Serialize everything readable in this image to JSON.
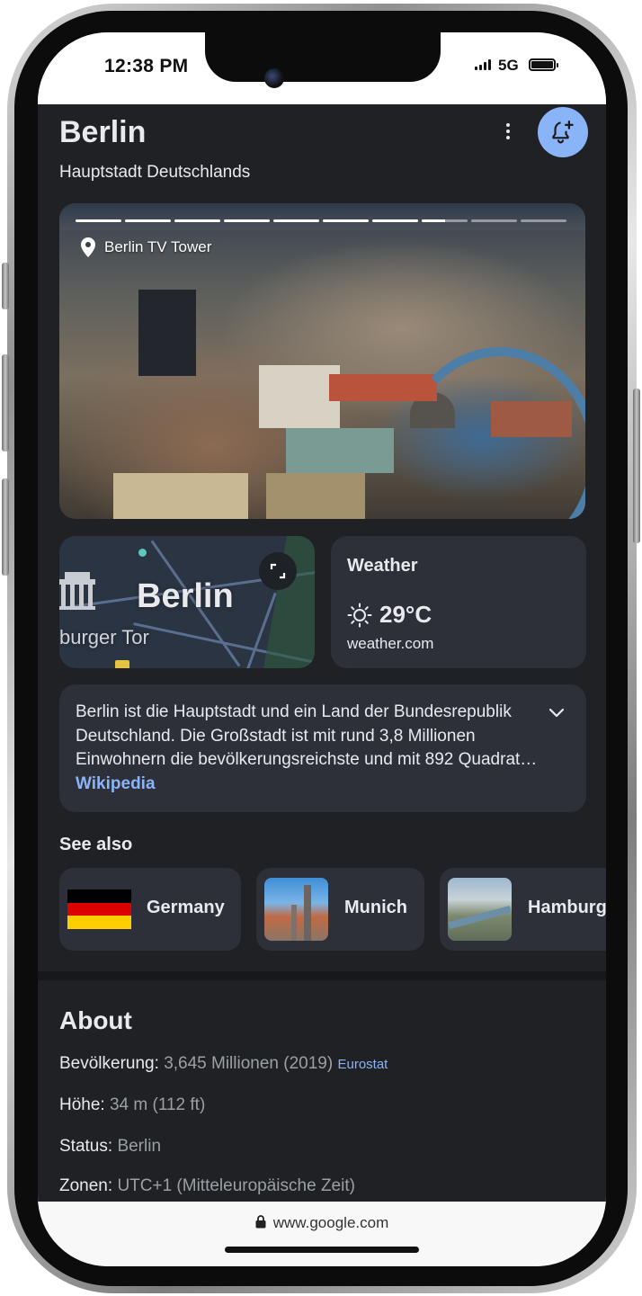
{
  "status_bar": {
    "time": "12:38 PM",
    "network": "5G",
    "battery_icon": "battery-full-icon"
  },
  "header": {
    "title": "Berlin",
    "subtitle": "Hauptstadt Deutschlands",
    "menu_icon": "more-vert-icon",
    "bell_icon": "bell-add-icon"
  },
  "hero": {
    "location_label": "Berlin TV Tower",
    "slide_count": 10,
    "current_slide": 8,
    "current_slide_progress": 0.5
  },
  "map": {
    "city_label": "Berlin",
    "landmark_label": "burger Tor",
    "expand_icon": "expand-icon"
  },
  "weather": {
    "title": "Weather",
    "temperature": "29°C",
    "condition_icon": "sun-icon",
    "source": "weather.com"
  },
  "description": {
    "text": "Berlin ist die Hauptstadt und ein Land der Bundesrepublik Deutschland. Die Großstadt ist mit rund 3,8 Millionen Einwohnern die bevölkerungsreichste und mit 892 Quadrat…",
    "link": "Wikipedia"
  },
  "see_also": {
    "title": "See also",
    "items": [
      {
        "label": "Germany"
      },
      {
        "label": "Munich"
      },
      {
        "label": "Hamburg"
      }
    ]
  },
  "about": {
    "title": "About",
    "facts": [
      {
        "label": "Bevölkerung:",
        "value": "3,645 Millionen (2019)",
        "source": "Eurostat"
      },
      {
        "label": "Höhe:",
        "value": "34 m (112 ft)"
      },
      {
        "label": "Status:",
        "value": "Berlin"
      },
      {
        "label": "Zonen:",
        "value": "UTC+1 (Mitteleuropäische Zeit)"
      }
    ]
  },
  "url_bar": {
    "url": "www.google.com"
  },
  "colors": {
    "background": "#202124",
    "card": "#2d3039",
    "link": "#8ab4f8",
    "accent_button": "#8ab4f8"
  }
}
